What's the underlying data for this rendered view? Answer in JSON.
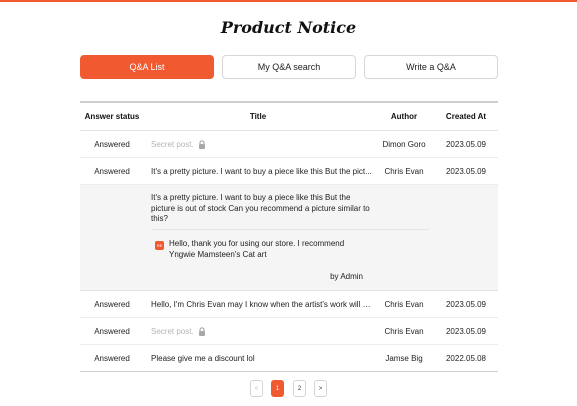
{
  "page": {
    "title": "Product Notice",
    "accent_color": "#f15a31"
  },
  "tabs": [
    {
      "label": "Q&A List",
      "active": true
    },
    {
      "label": "My Q&A search",
      "active": false
    },
    {
      "label": "Write a Q&A",
      "active": false
    }
  ],
  "table": {
    "headers": {
      "status": "Answer status",
      "title": "Title",
      "author": "Author",
      "created": "Created At"
    },
    "rows": [
      {
        "status": "Answered",
        "title": "Secret post.",
        "secret": true,
        "author": "Dimon Goro",
        "created": "2023.05.09"
      },
      {
        "status": "Answered",
        "title": "It's a pretty picture. I want to buy a piece like this But the pict...",
        "secret": false,
        "author": "Chris Evan",
        "created": "2023.05.09"
      },
      {
        "status": "Answered",
        "title": "Hello, I'm Chris Evan may I know when the artist's work will b...",
        "secret": false,
        "author": "Chris Evan",
        "created": "2023.05.09"
      },
      {
        "status": "Answered",
        "title": "Secret post.",
        "secret": true,
        "author": "Chris Evan",
        "created": "2023.05.09"
      },
      {
        "status": "Answered",
        "title": "Please give me a discount lol",
        "secret": false,
        "author": "Jamse Big",
        "created": "2022.05.08"
      }
    ],
    "expanded": {
      "question": "It's a pretty picture. I want to buy a piece like this But the picture is out of stock Can you recommend a picture similar to this?",
      "answer_badge": "RE",
      "answer": "Hello, thank you for using our store. I recommend Yngwie Mamsteen's Cat art",
      "by": "by Admin"
    }
  },
  "pagination": {
    "prev": "<",
    "pages": [
      "1",
      "2"
    ],
    "current": "1",
    "next": ">"
  },
  "icons": {
    "lock": "lock-icon"
  }
}
